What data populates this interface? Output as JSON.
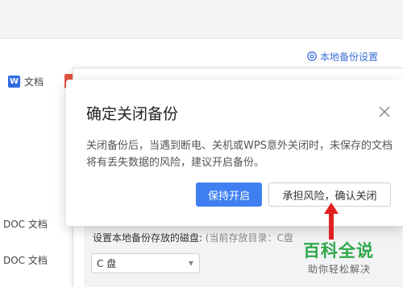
{
  "background": {
    "local_backup_setting": "本地备份设置",
    "doc_tab": "文档",
    "file_rows": [
      "DOC 文档",
      "DOC 文档"
    ],
    "disk_label": "设置本地备份存放的磁盘:",
    "disk_hint": "(当前存放目录：C盘",
    "disk_select_value": "C 盘"
  },
  "dialog": {
    "title": "确定关闭备份",
    "message": "关闭备份后，当遇到断电、关机或WPS意外关闭时，未保存的文档将有丢失数据的风险，建议开启备份。",
    "keep_button": "保持开启",
    "confirm_button": "承担风险，确认关闭"
  },
  "watermark": {
    "title": "百科全说",
    "subtitle": "助你轻松解决"
  },
  "colors": {
    "primary": "#3f7ff2",
    "link": "#3b6fd6",
    "arrow": "#e02020",
    "watermark": "#2fa84a"
  }
}
